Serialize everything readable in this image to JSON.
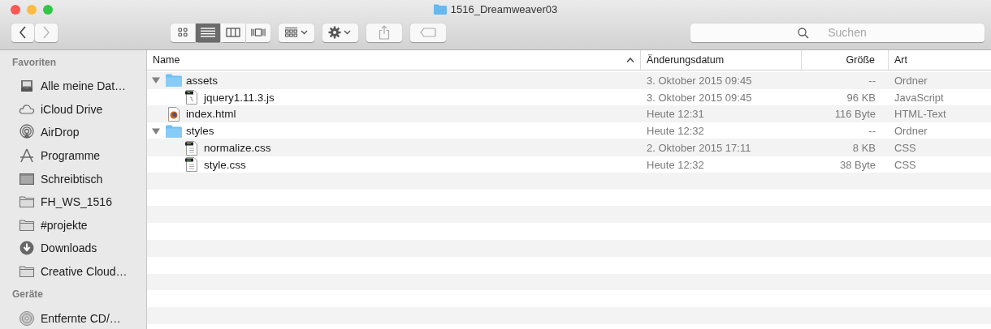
{
  "window": {
    "title": "1516_Dreamweaver03"
  },
  "toolbar": {
    "view_buttons": [
      {
        "kind": "icons",
        "selected": false
      },
      {
        "kind": "list",
        "selected": true
      },
      {
        "kind": "columns",
        "selected": false
      },
      {
        "kind": "coverflow",
        "selected": false
      }
    ],
    "search": {
      "placeholder": "Suchen"
    }
  },
  "sidebar": {
    "sections": [
      {
        "title": "Favoriten",
        "items": [
          {
            "label": "Alle meine Dat…",
            "kind": "allfiles"
          },
          {
            "label": "iCloud Drive",
            "kind": "cloud"
          },
          {
            "label": "AirDrop",
            "kind": "airdrop"
          },
          {
            "label": "Programme",
            "kind": "apps"
          },
          {
            "label": "Schreibtisch",
            "kind": "desktop"
          },
          {
            "label": "FH_WS_1516",
            "kind": "folder"
          },
          {
            "label": "#projekte",
            "kind": "folder"
          },
          {
            "label": "Downloads",
            "kind": "download"
          },
          {
            "label": "Creative Cloud…",
            "kind": "folder"
          }
        ]
      },
      {
        "title": "Geräte",
        "items": [
          {
            "label": "Entfernte CD/…",
            "kind": "disc"
          }
        ]
      }
    ]
  },
  "table": {
    "columns": [
      "Name",
      "Änderungsdatum",
      "Größe",
      "Art"
    ],
    "rows": [
      {
        "name": "assets",
        "kind": "folder",
        "expanded": true,
        "date": "3. Oktober 2015 09:45",
        "size": "--",
        "type": "Ordner",
        "children": [
          {
            "name": "jquery1.11.3.js",
            "kind": "js",
            "date": "3. Oktober 2015 09:45",
            "size": "96 KB",
            "type": "JavaScript"
          }
        ]
      },
      {
        "name": "index.html",
        "kind": "html",
        "date": "Heute 12:31",
        "size": "116 Byte",
        "type": "HTML-Text"
      },
      {
        "name": "styles",
        "kind": "folder",
        "expanded": true,
        "date": "Heute 12:32",
        "size": "--",
        "type": "Ordner",
        "children": [
          {
            "name": "normalize.css",
            "kind": "css",
            "date": "2. Oktober 2015 17:11",
            "size": "8 KB",
            "type": "CSS"
          },
          {
            "name": "style.css",
            "kind": "css",
            "date": "Heute 12:32",
            "size": "38 Byte",
            "type": "CSS"
          }
        ]
      }
    ]
  }
}
